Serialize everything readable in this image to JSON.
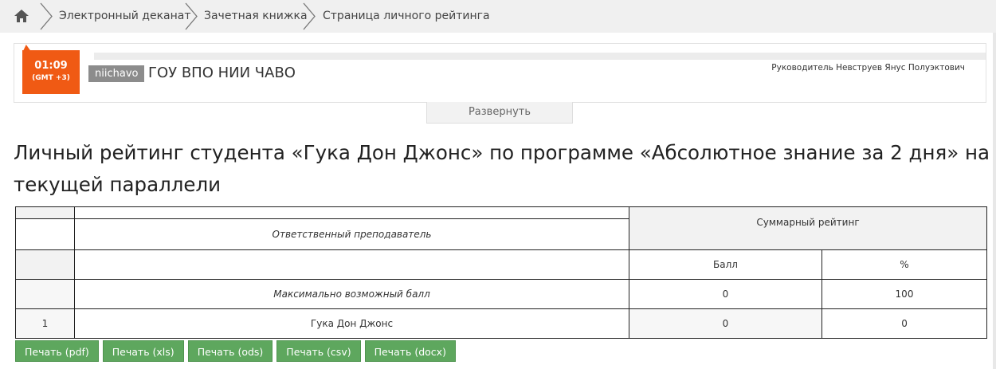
{
  "breadcrumb": {
    "items": [
      {
        "label": "Электронный деканат"
      },
      {
        "label": "Зачетная книжка"
      },
      {
        "label": "Страница личного рейтинга"
      }
    ]
  },
  "header": {
    "time": "01:09",
    "timezone": "(GMT +3)",
    "org_short": "niichavo",
    "org_name": "ГОУ ВПО НИИ ЧАВО",
    "head_person": "Руководитель Невструев Янус Полуэктович",
    "expand_label": "Развернуть"
  },
  "page_title": "Личный рейтинг студента «Гука Дон Джонс» по программе «Абсолютное знание за 2 дня» на текущей параллели",
  "table": {
    "teacher_header": "Ответственный преподаватель",
    "sum_header": "Суммарный рейтинг",
    "ball_header": "Балл",
    "pct_header": "%",
    "max_row": {
      "label": "Максимально возможный балл",
      "ball": "0",
      "pct": "100"
    },
    "rows": [
      {
        "num": "1",
        "name": "Гука Дон Джонс",
        "ball": "0",
        "pct": "0"
      }
    ]
  },
  "print_buttons": [
    {
      "label": "Печать (pdf)"
    },
    {
      "label": "Печать (xls)"
    },
    {
      "label": "Печать (ods)"
    },
    {
      "label": "Печать (csv)"
    },
    {
      "label": "Печать (docx)"
    }
  ],
  "colors": {
    "accent_orange": "#f05a14",
    "button_green": "#5ea75e",
    "badge_gray": "#8c8c8c"
  },
  "icons": {
    "home": "home-icon",
    "separator": "chevron-right-icon"
  }
}
